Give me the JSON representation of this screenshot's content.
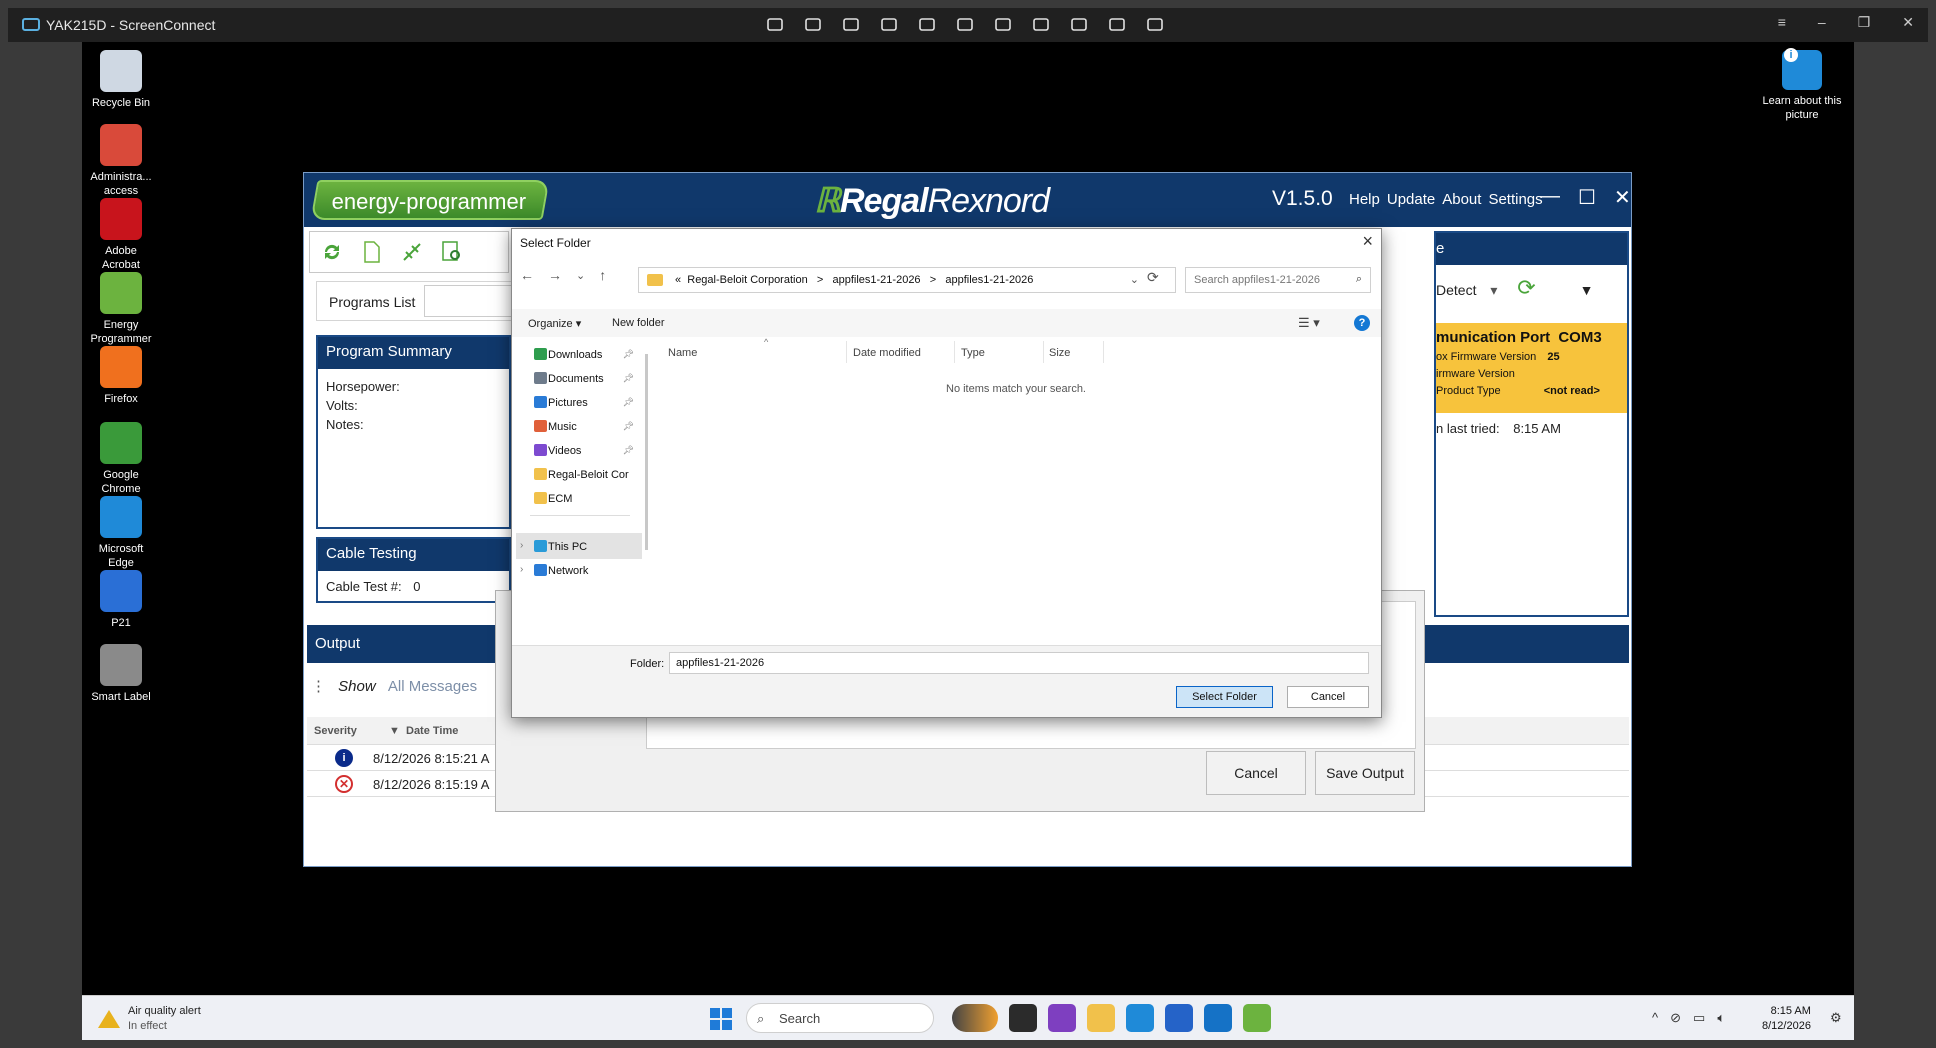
{
  "screenconnect": {
    "title": "YAK215D - ScreenConnect",
    "tools": [
      "display-icon",
      "lightning-icon",
      "toolbox-icon",
      "swap-icon",
      "camera-icon",
      "microphone-icon",
      "users-icon",
      "pen-icon",
      "chat-icon",
      "plus-icon",
      "info-icon"
    ],
    "window_controls": [
      "≡",
      "–",
      "❐",
      "✕"
    ]
  },
  "desktop": {
    "icons": [
      {
        "label": "Recycle Bin",
        "icon": "recycle-bin-icon",
        "color": "#cfd8e3"
      },
      {
        "label": "Administra... access",
        "icon": "admin-access-icon",
        "color": "#d94a3a"
      },
      {
        "label": "Adobe Acrobat",
        "icon": "acrobat-icon",
        "color": "#c8141c"
      },
      {
        "label": "Energy Programmer",
        "icon": "energy-programmer-icon",
        "color": "#6cb33f"
      },
      {
        "label": "Firefox",
        "icon": "firefox-icon",
        "color": "#f0701e"
      },
      {
        "label": "Google Chrome",
        "icon": "chrome-icon",
        "color": "#3a9a3a"
      },
      {
        "label": "Microsoft Edge",
        "icon": "edge-icon",
        "color": "#1f8ad8"
      },
      {
        "label": "P21",
        "icon": "p21-icon",
        "color": "#2a6fd6"
      },
      {
        "label": "Smart Label",
        "icon": "smart-label-icon",
        "color": "#8a8a8a"
      }
    ],
    "learn": "Learn about this picture"
  },
  "ep": {
    "logo": "energy-programmer",
    "brand_a": "Regal",
    "brand_b": "Rexnord",
    "version": "V1.5.0",
    "menu": [
      "Help",
      "Update",
      "About",
      "Settings"
    ],
    "programs_list": "Programs List",
    "summary_title": "Program Summary",
    "summary_fields": [
      "Horsepower:",
      "Volts:",
      "Notes:"
    ],
    "cable_title": "Cable Testing",
    "cable_test_label": "Cable Test #:",
    "cable_test_value": "0",
    "output_title": "Output",
    "show_label": "Show",
    "show_value": "All Messages",
    "table_headers": {
      "severity": "Severity",
      "datetime": "Date Time"
    },
    "rows": [
      {
        "severity": "info",
        "datetime": "8/12/2026 8:15:21 A"
      },
      {
        "severity": "error",
        "datetime": "8/12/2026 8:15:19 A"
      }
    ],
    "right_head": "e",
    "detect": "Detect",
    "comm_port": "munication Port",
    "comm_port_value": "COM3",
    "fw1_label": "ox Firmware Version",
    "fw1_value": "25",
    "fw2_label": "irmware Version",
    "product_label": "Product Type",
    "product_value": "<not read>",
    "last_tried_label": "n last tried:",
    "last_tried_value": "8:15 AM",
    "cancel": "Cancel",
    "save_output": "Save Output"
  },
  "dialog": {
    "title": "Select Folder",
    "address": [
      "«",
      "Regal-Beloit Corporation",
      ">",
      "appfiles1-21-2026",
      ">",
      "appfiles1-21-2026"
    ],
    "search_placeholder": "Search appfiles1-21-2026",
    "organize": "Organize ▾",
    "new_folder": "New folder",
    "tree": [
      {
        "label": "Downloads",
        "pinned": true,
        "color": "#2e9d4e"
      },
      {
        "label": "Documents",
        "pinned": true,
        "color": "#6e7b8b"
      },
      {
        "label": "Pictures",
        "pinned": true,
        "color": "#2a7bd6"
      },
      {
        "label": "Music",
        "pinned": true,
        "color": "#e0603a"
      },
      {
        "label": "Videos",
        "pinned": true,
        "color": "#7d4ad0"
      },
      {
        "label": "Regal-Beloit Cor",
        "pinned": false,
        "color": "#f1c14b"
      },
      {
        "label": "ECM",
        "pinned": false,
        "color": "#f1c14b"
      },
      {
        "label": "This PC",
        "pinned": false,
        "color": "#2a9bd8"
      },
      {
        "label": "Network",
        "pinned": false,
        "color": "#2a7bd6"
      }
    ],
    "columns": [
      "Name",
      "Date modified",
      "Type",
      "Size"
    ],
    "empty": "No items match your search.",
    "folder_label": "Folder:",
    "folder_value": "appfiles1-21-2026",
    "select_btn": "Select Folder",
    "cancel_btn": "Cancel"
  },
  "taskbar": {
    "weather_title": "Air quality alert",
    "weather_sub": "In effect",
    "search": "Search",
    "apps": [
      "toggle-app-icon",
      "terminal-icon",
      "m365-icon",
      "file-explorer-icon",
      "edge-icon",
      "store-icon",
      "outlook-icon",
      "energy-programmer-icon"
    ],
    "time": "8:15 AM",
    "date": "8/12/2026"
  }
}
